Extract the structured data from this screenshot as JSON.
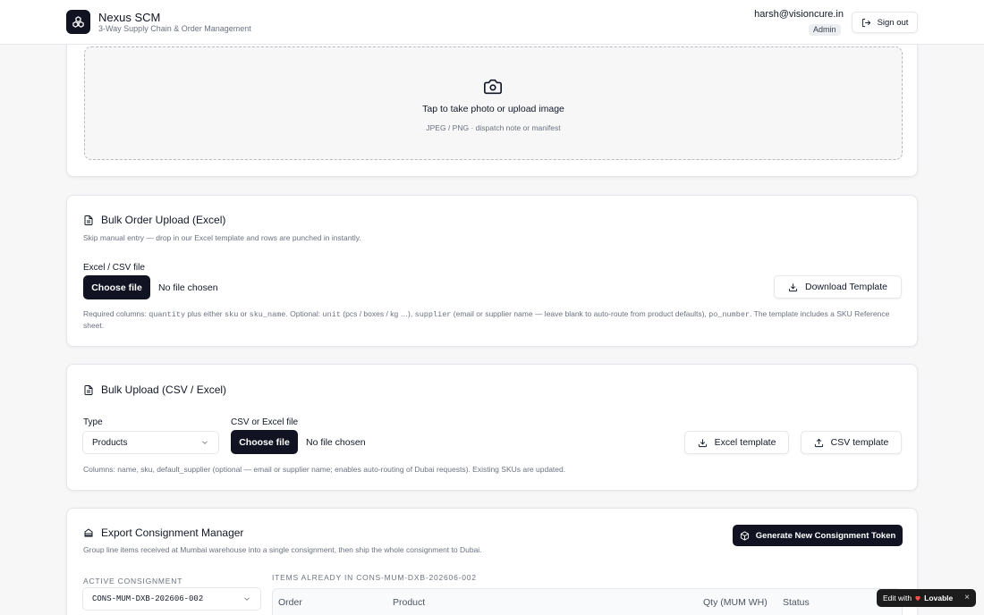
{
  "header": {
    "app_name": "Nexus SCM",
    "app_subtitle": "3-Way Supply Chain & Order Management",
    "user_email": "harsh@visioncure.in",
    "role": "Admin",
    "signout_label": "Sign out"
  },
  "photo_upload": {
    "title": "Tap to take photo or upload image",
    "subtitle": "JPEG / PNG · dispatch note or manifest"
  },
  "bulk_order": {
    "title": "Bulk Order Upload (Excel)",
    "description": "Skip manual entry — drop in our Excel template and rows are punched in instantly.",
    "file_label": "Excel / CSV file",
    "choose_label": "Choose file",
    "no_file": "No file chosen",
    "download_template": "Download Template",
    "help": {
      "t1": "Required columns: ",
      "c1": "quantity",
      "t2": " plus either ",
      "c2": "sku",
      "t3": " or ",
      "c3": "sku_name",
      "t4": ". Optional: ",
      "c4": "unit",
      "t5": " (pcs / boxes / kg …), ",
      "c5": "supplier",
      "t6": " (email or supplier name — leave blank to auto-route from product defaults), ",
      "c6": "po_number",
      "t7": ". The template includes a SKU Reference sheet."
    }
  },
  "bulk_upload": {
    "title": "Bulk Upload (CSV / Excel)",
    "type_label": "Type",
    "type_value": "Products",
    "file_label": "CSV or Excel file",
    "choose_label": "Choose file",
    "no_file": "No file chosen",
    "excel_template": "Excel template",
    "csv_template": "CSV template",
    "help": "Columns: name, sku, default_supplier (optional — email or supplier name; enables auto-routing of Dubai requests). Existing SKUs are updated."
  },
  "consignment": {
    "title": "Export Consignment Manager",
    "description": "Group line items received at Mumbai warehouse into a single consignment, then ship the whole consignment to Dubai.",
    "generate_label": "Generate New Consignment Token",
    "active_label": "ACTIVE CONSIGNMENT",
    "active_value": "CONS-MUM-DXB-202606-002",
    "items_label": "ITEMS ALREADY IN CONS-MUM-DXB-202606-002",
    "columns": [
      "Order",
      "Product",
      "Qty (MUM WH)",
      "Status"
    ]
  },
  "badge": {
    "edit_with": "Edit with",
    "brand": "Lovable",
    "close": "×"
  }
}
